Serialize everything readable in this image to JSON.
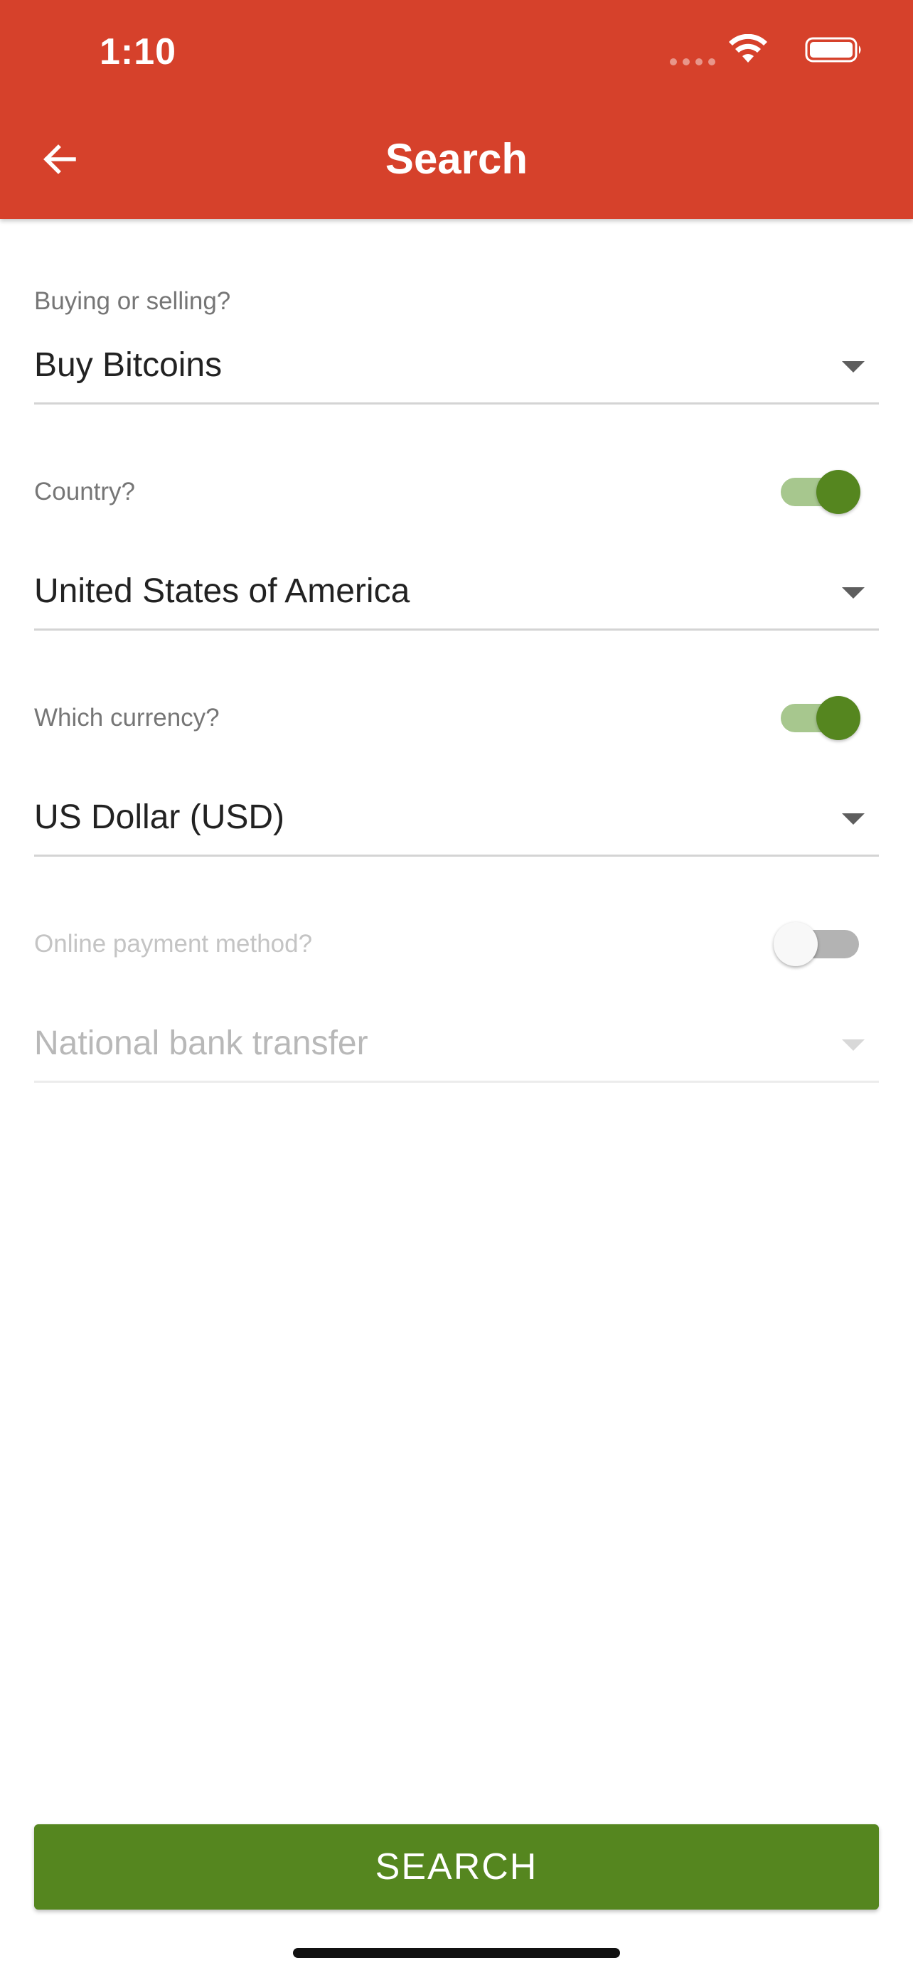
{
  "status_bar": {
    "time": "1:10"
  },
  "header": {
    "title": "Search"
  },
  "form": {
    "trade": {
      "label": "Buying or selling?",
      "value": "Buy Bitcoins"
    },
    "country": {
      "label": "Country?",
      "toggle_on": true,
      "value": "United States of America"
    },
    "currency": {
      "label": "Which currency?",
      "toggle_on": true,
      "value": "US Dollar (USD)"
    },
    "payment": {
      "label": "Online payment method?",
      "toggle_on": false,
      "value": "National bank transfer"
    }
  },
  "search_button": {
    "label": "SEARCH"
  },
  "colors": {
    "app_bar": "#d6412b",
    "accent_green": "#55861f",
    "toggle_track_on": "#a7c78e"
  },
  "icons": {
    "back": "arrow-left-icon",
    "dropdown": "caret-down-icon",
    "wifi": "wifi-icon",
    "battery": "battery-icon",
    "signal": "cellular-signal-icon"
  }
}
